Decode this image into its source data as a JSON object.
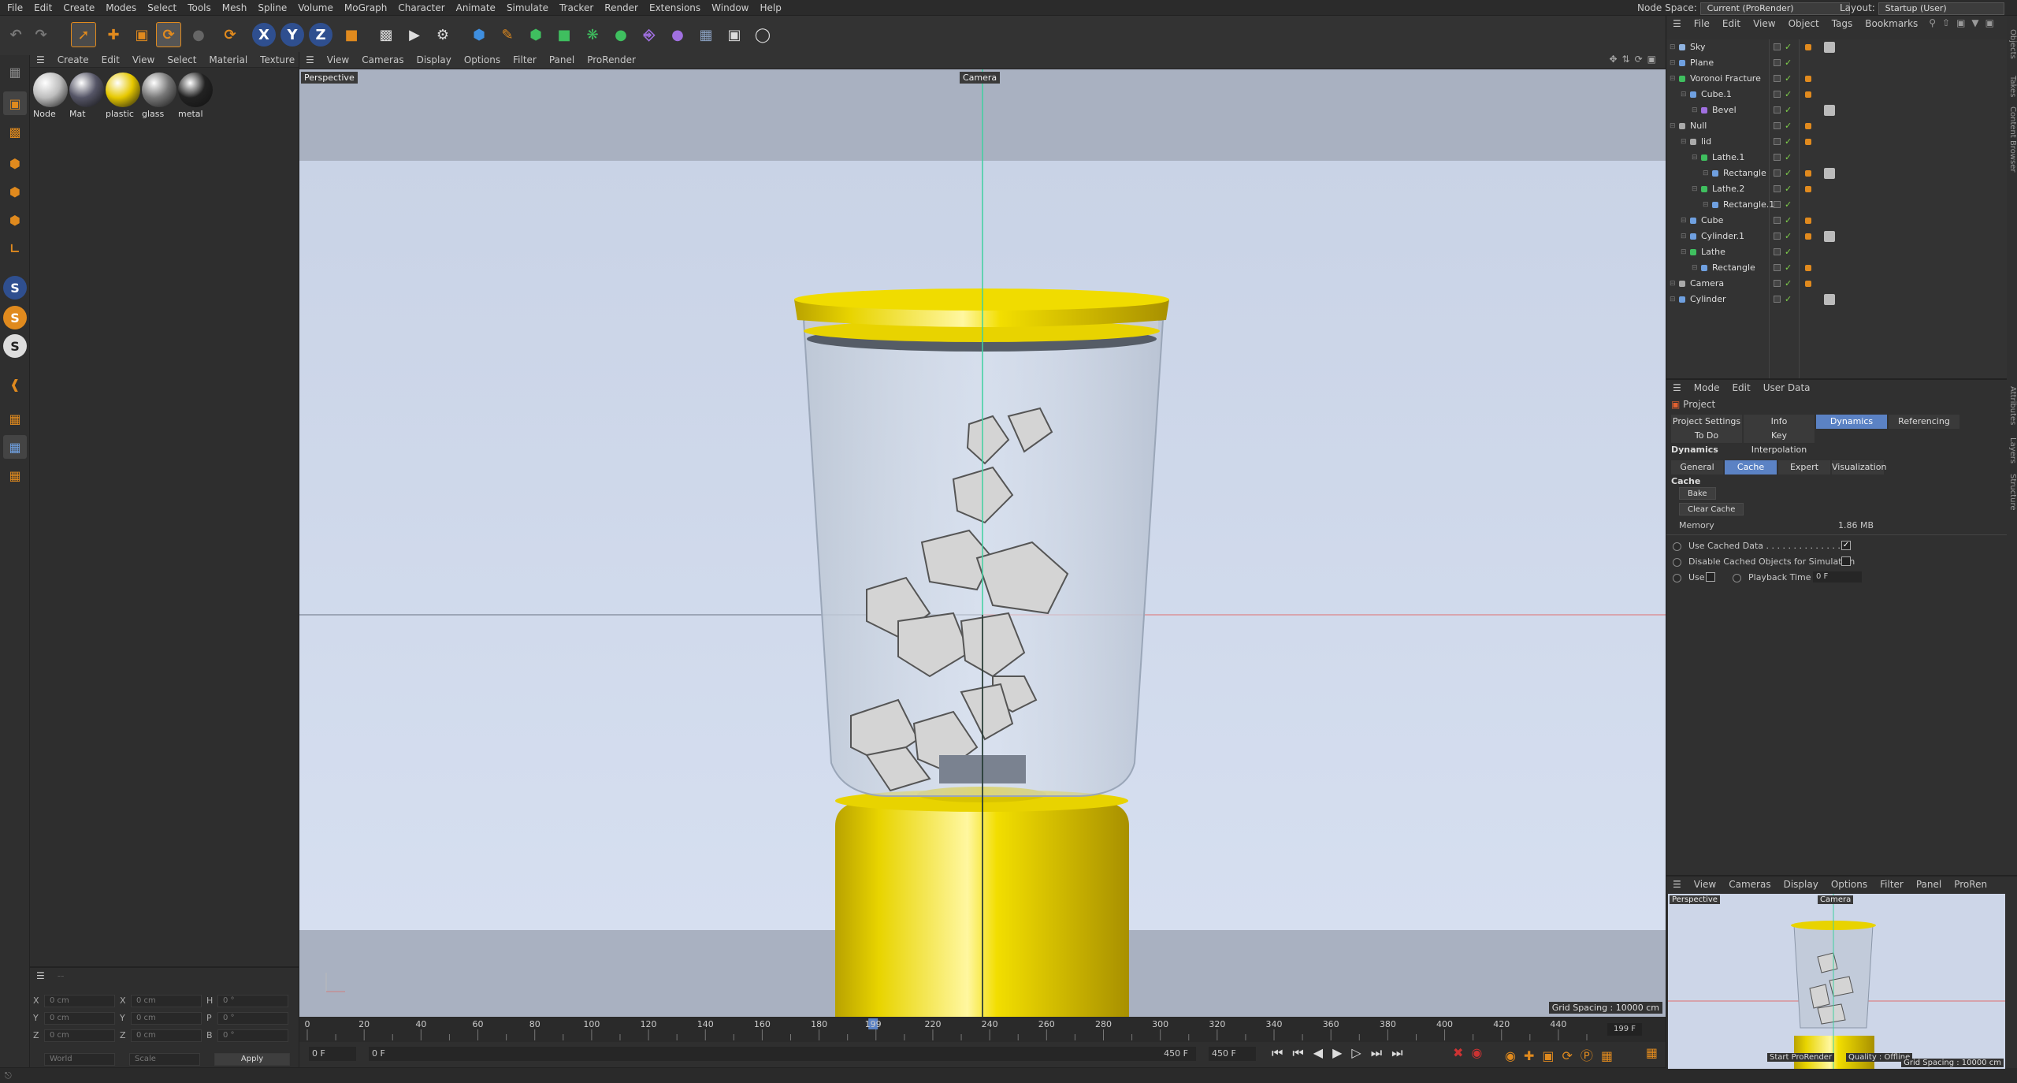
{
  "menubar": {
    "items": [
      "File",
      "Edit",
      "Create",
      "Modes",
      "Select",
      "Tools",
      "Mesh",
      "Spline",
      "Volume",
      "MoGraph",
      "Character",
      "Animate",
      "Simulate",
      "Tracker",
      "Render",
      "Extensions",
      "Window",
      "Help"
    ],
    "node_space_label": "Node Space:",
    "node_space_value": "Current (ProRender)",
    "layout_label": "Layout:",
    "layout_value": "Startup (User)"
  },
  "toolbar": {
    "axis_x": "X",
    "axis_y": "Y",
    "axis_z": "Z"
  },
  "lefttools": {
    "s1": "S",
    "s2": "S",
    "s3": "S"
  },
  "material_manager": {
    "menu": [
      "Create",
      "Edit",
      "View",
      "Select",
      "Material",
      "Texture"
    ],
    "materials": [
      {
        "name": "Node",
        "color": "#bdbdbd"
      },
      {
        "name": "Mat",
        "color": "#556"
      },
      {
        "name": "plastic",
        "color": "#e6c800"
      },
      {
        "name": "glass",
        "color": "#777"
      },
      {
        "name": "metal",
        "color": "#222"
      }
    ]
  },
  "coords": {
    "rows": [
      {
        "a": "X",
        "av": "0 cm",
        "b": "X",
        "bv": "0 cm",
        "c": "H",
        "cv": "0 °"
      },
      {
        "a": "Y",
        "av": "0 cm",
        "b": "Y",
        "bv": "0 cm",
        "c": "P",
        "cv": "0 °"
      },
      {
        "a": "Z",
        "av": "0 cm",
        "b": "Z",
        "bv": "0 cm",
        "c": "B",
        "cv": "0 °"
      }
    ],
    "world": "World",
    "scale": "Scale",
    "apply": "Apply"
  },
  "viewport": {
    "menu": [
      "View",
      "Cameras",
      "Display",
      "Options",
      "Filter",
      "Panel",
      "ProRender"
    ],
    "label": "Perspective",
    "camera_label": "Camera",
    "grid_spacing": "Grid Spacing : 10000 cm"
  },
  "timeline": {
    "ticks": [
      "0",
      "20",
      "40",
      "60",
      "80",
      "100",
      "120",
      "140",
      "160",
      "180",
      "199",
      "220",
      "240",
      "260",
      "280",
      "300",
      "320",
      "340",
      "360",
      "380",
      "400",
      "420",
      "440"
    ],
    "end_frame": "199 F",
    "current_frame": 199,
    "max_frame": 450
  },
  "transport": {
    "start": "0 F",
    "field2": "0 F",
    "end1": "450 F",
    "end2": "450 F"
  },
  "objects": {
    "menu": [
      "File",
      "Edit",
      "View",
      "Object",
      "Tags",
      "Bookmarks"
    ],
    "items": [
      {
        "name": "Sky",
        "indent": 0,
        "icon": "#8fb3e0"
      },
      {
        "name": "Plane",
        "indent": 0,
        "icon": "#6fa0e0"
      },
      {
        "name": "Voronoi Fracture",
        "indent": 0,
        "icon": "#3fbf5f"
      },
      {
        "name": "Cube.1",
        "indent": 1,
        "icon": "#6fa0e0"
      },
      {
        "name": "Bevel",
        "indent": 2,
        "icon": "#a070e0"
      },
      {
        "name": "Null",
        "indent": 0,
        "icon": "#aaaaaa"
      },
      {
        "name": "lid",
        "indent": 1,
        "icon": "#aaaaaa"
      },
      {
        "name": "Lathe.1",
        "indent": 2,
        "icon": "#3fbf5f"
      },
      {
        "name": "Rectangle",
        "indent": 3,
        "icon": "#6fa0e0"
      },
      {
        "name": "Lathe.2",
        "indent": 2,
        "icon": "#3fbf5f"
      },
      {
        "name": "Rectangle.1",
        "indent": 3,
        "icon": "#6fa0e0"
      },
      {
        "name": "Cube",
        "indent": 1,
        "icon": "#6fa0e0"
      },
      {
        "name": "Cylinder.1",
        "indent": 1,
        "icon": "#6fa0e0"
      },
      {
        "name": "Lathe",
        "indent": 1,
        "icon": "#3fbf5f"
      },
      {
        "name": "Rectangle",
        "indent": 2,
        "icon": "#6fa0e0"
      },
      {
        "name": "Camera",
        "indent": 0,
        "icon": "#aaaaaa"
      },
      {
        "name": "Cylinder",
        "indent": 0,
        "icon": "#6fa0e0"
      }
    ]
  },
  "attributes": {
    "menu": [
      "Mode",
      "Edit",
      "User Data"
    ],
    "title": "Project",
    "tabs1": [
      "Project Settings",
      "Info",
      "Dynamics",
      "Referencing"
    ],
    "tabs2": [
      "To Do",
      "Key Interpolation"
    ],
    "section": "Dynamics",
    "subtabs": [
      "General",
      "Cache",
      "Expert",
      "Visualization"
    ],
    "cache_title": "Cache",
    "bake": "Bake",
    "clear_cache": "Clear Cache",
    "memory_label": "Memory",
    "memory_value": "1.86 MB",
    "use_cached": "Use Cached Data . . . . . . . . . . . . . .",
    "disable_cached": "Disable Cached Objects for Simulation",
    "use": "Use",
    "playback_time": "Playback Time",
    "playback_value": "0 F"
  },
  "side_tabs": {
    "objects": "Objects",
    "takes": "Takes",
    "content": "Content Browser",
    "attributes": "Attributes",
    "layers": "Layers",
    "structure": "Structure"
  },
  "mini_viewport": {
    "menu": [
      "View",
      "Cameras",
      "Display",
      "Options",
      "Filter",
      "Panel",
      "ProRen"
    ],
    "label": "Perspective",
    "camera": "Camera",
    "start_prorender": "Start ProRender",
    "quality": "Quality : Offline",
    "grid": "Grid Spacing : 10000 cm"
  }
}
